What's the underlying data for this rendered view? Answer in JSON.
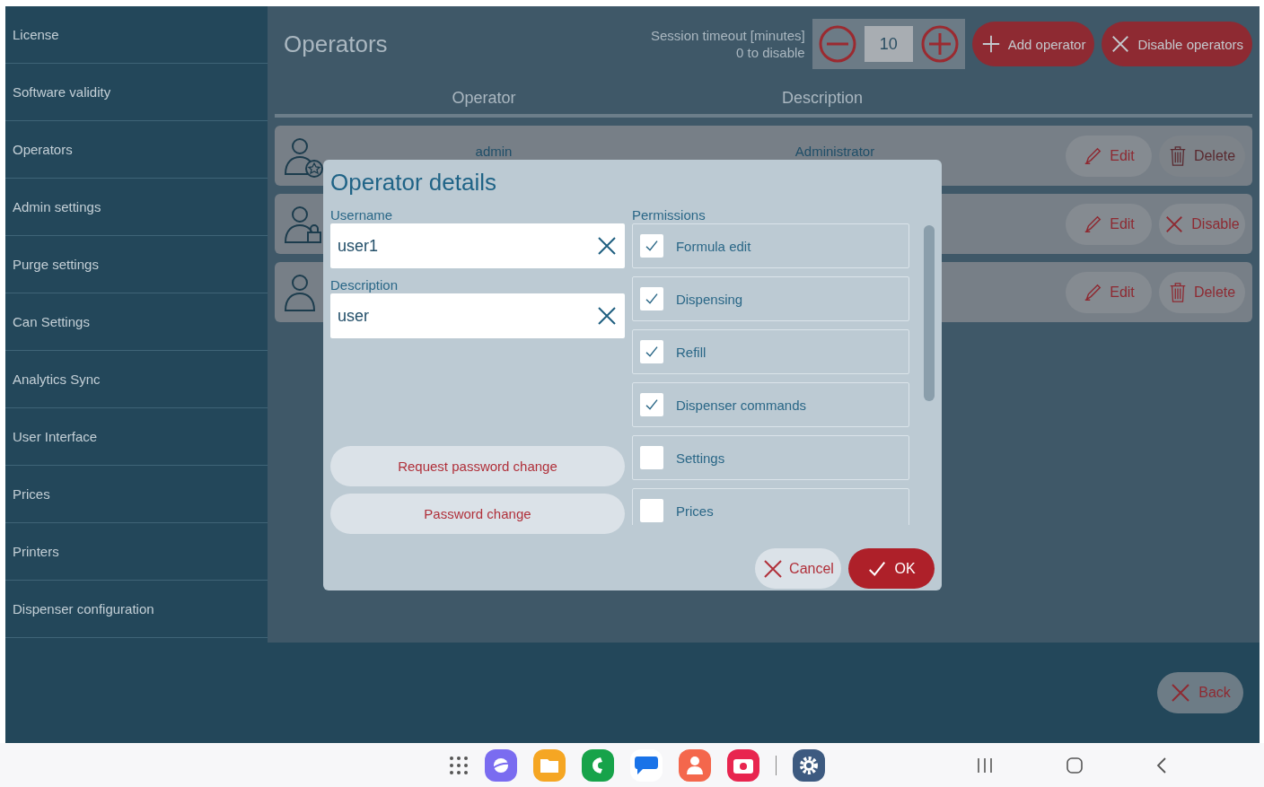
{
  "sidebar": {
    "items": [
      {
        "label": "License"
      },
      {
        "label": "Software validity"
      },
      {
        "label": "Operators"
      },
      {
        "label": "Admin settings"
      },
      {
        "label": "Purge settings"
      },
      {
        "label": "Can Settings"
      },
      {
        "label": "Analytics Sync"
      },
      {
        "label": "User Interface"
      },
      {
        "label": "Prices"
      },
      {
        "label": "Printers"
      },
      {
        "label": "Dispenser configuration"
      }
    ]
  },
  "header": {
    "title": "Operators",
    "timeout_label": "Session timeout [minutes]",
    "timeout_hint": "0 to disable",
    "timeout_value": "10",
    "buttons": [
      {
        "kind": "add",
        "label": "Add operator"
      },
      {
        "kind": "disable",
        "label": "Disable operators"
      }
    ]
  },
  "table": {
    "columns": [
      "Operator",
      "Description"
    ],
    "rows": [
      {
        "kind": "admin",
        "operator": "admin",
        "description": "Administrator",
        "actions": [
          {
            "kind": "edit",
            "label": "Edit",
            "disabled": false
          },
          {
            "kind": "delete",
            "label": "Delete",
            "disabled": true
          }
        ]
      },
      {
        "kind": "locked",
        "actions": [
          {
            "kind": "edit",
            "label": "Edit",
            "disabled": false
          },
          {
            "kind": "disable",
            "label": "Disable",
            "disabled": false
          }
        ]
      },
      {
        "kind": "user",
        "actions": [
          {
            "kind": "edit",
            "label": "Edit",
            "disabled": false
          },
          {
            "kind": "delete",
            "label": "Delete",
            "disabled": false
          }
        ]
      }
    ]
  },
  "dialog": {
    "title": "Operator details",
    "username": {
      "label": "Username",
      "value": "user1"
    },
    "description": {
      "label": "Description",
      "value": "user"
    },
    "buttons": [
      {
        "label": "Request password change"
      },
      {
        "label": "Password change"
      }
    ],
    "permissions_label": "Permissions",
    "permissions": [
      {
        "label": "Formula edit",
        "checked": true
      },
      {
        "label": "Dispensing",
        "checked": true
      },
      {
        "label": "Refill",
        "checked": true
      },
      {
        "label": "Dispenser commands",
        "checked": true
      },
      {
        "label": "Settings",
        "checked": false
      },
      {
        "label": "Prices",
        "checked": false
      }
    ],
    "cancel": "Cancel",
    "ok": "OK"
  },
  "back": "Back"
}
